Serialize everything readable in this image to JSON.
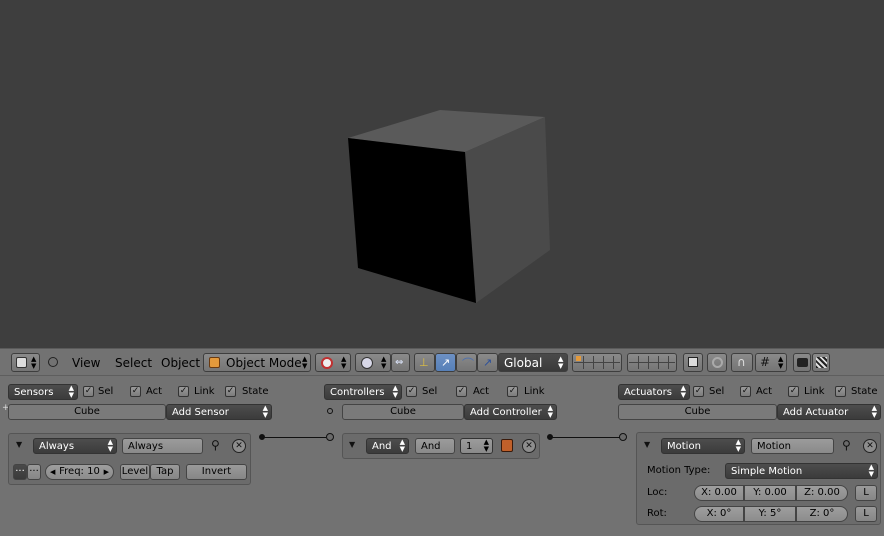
{
  "header": {
    "menus": [
      "View",
      "Select",
      "Object"
    ],
    "mode": "Object Mode",
    "orientation": "Global"
  },
  "logic": {
    "sensors": {
      "column_label": "Sensors",
      "filters": [
        "Sel",
        "Act",
        "Link",
        "State"
      ],
      "object": "Cube",
      "add_label": "Add Sensor",
      "brick": {
        "type": "Always",
        "name": "Always",
        "freq": "Freq: 10",
        "level": "Level",
        "tap": "Tap",
        "invert": "Invert"
      }
    },
    "controllers": {
      "column_label": "Controllers",
      "filters": [
        "Sel",
        "Act",
        "Link"
      ],
      "object": "Cube",
      "add_label": "Add Controller",
      "brick": {
        "type": "And",
        "name": "And",
        "state": "1"
      }
    },
    "actuators": {
      "column_label": "Actuators",
      "filters": [
        "Sel",
        "Act",
        "Link",
        "State"
      ],
      "object": "Cube",
      "add_label": "Add Actuator",
      "brick": {
        "type": "Motion",
        "name": "Motion",
        "motion_type_label": "Motion Type:",
        "motion_type": "Simple Motion",
        "loc_label": "Loc:",
        "loc": [
          "X: 0.00",
          "Y: 0.00",
          "Z: 0.00"
        ],
        "rot_label": "Rot:",
        "rot": [
          "X: 0°",
          "Y: 5°",
          "Z: 0°"
        ],
        "local_label": "L"
      }
    }
  }
}
